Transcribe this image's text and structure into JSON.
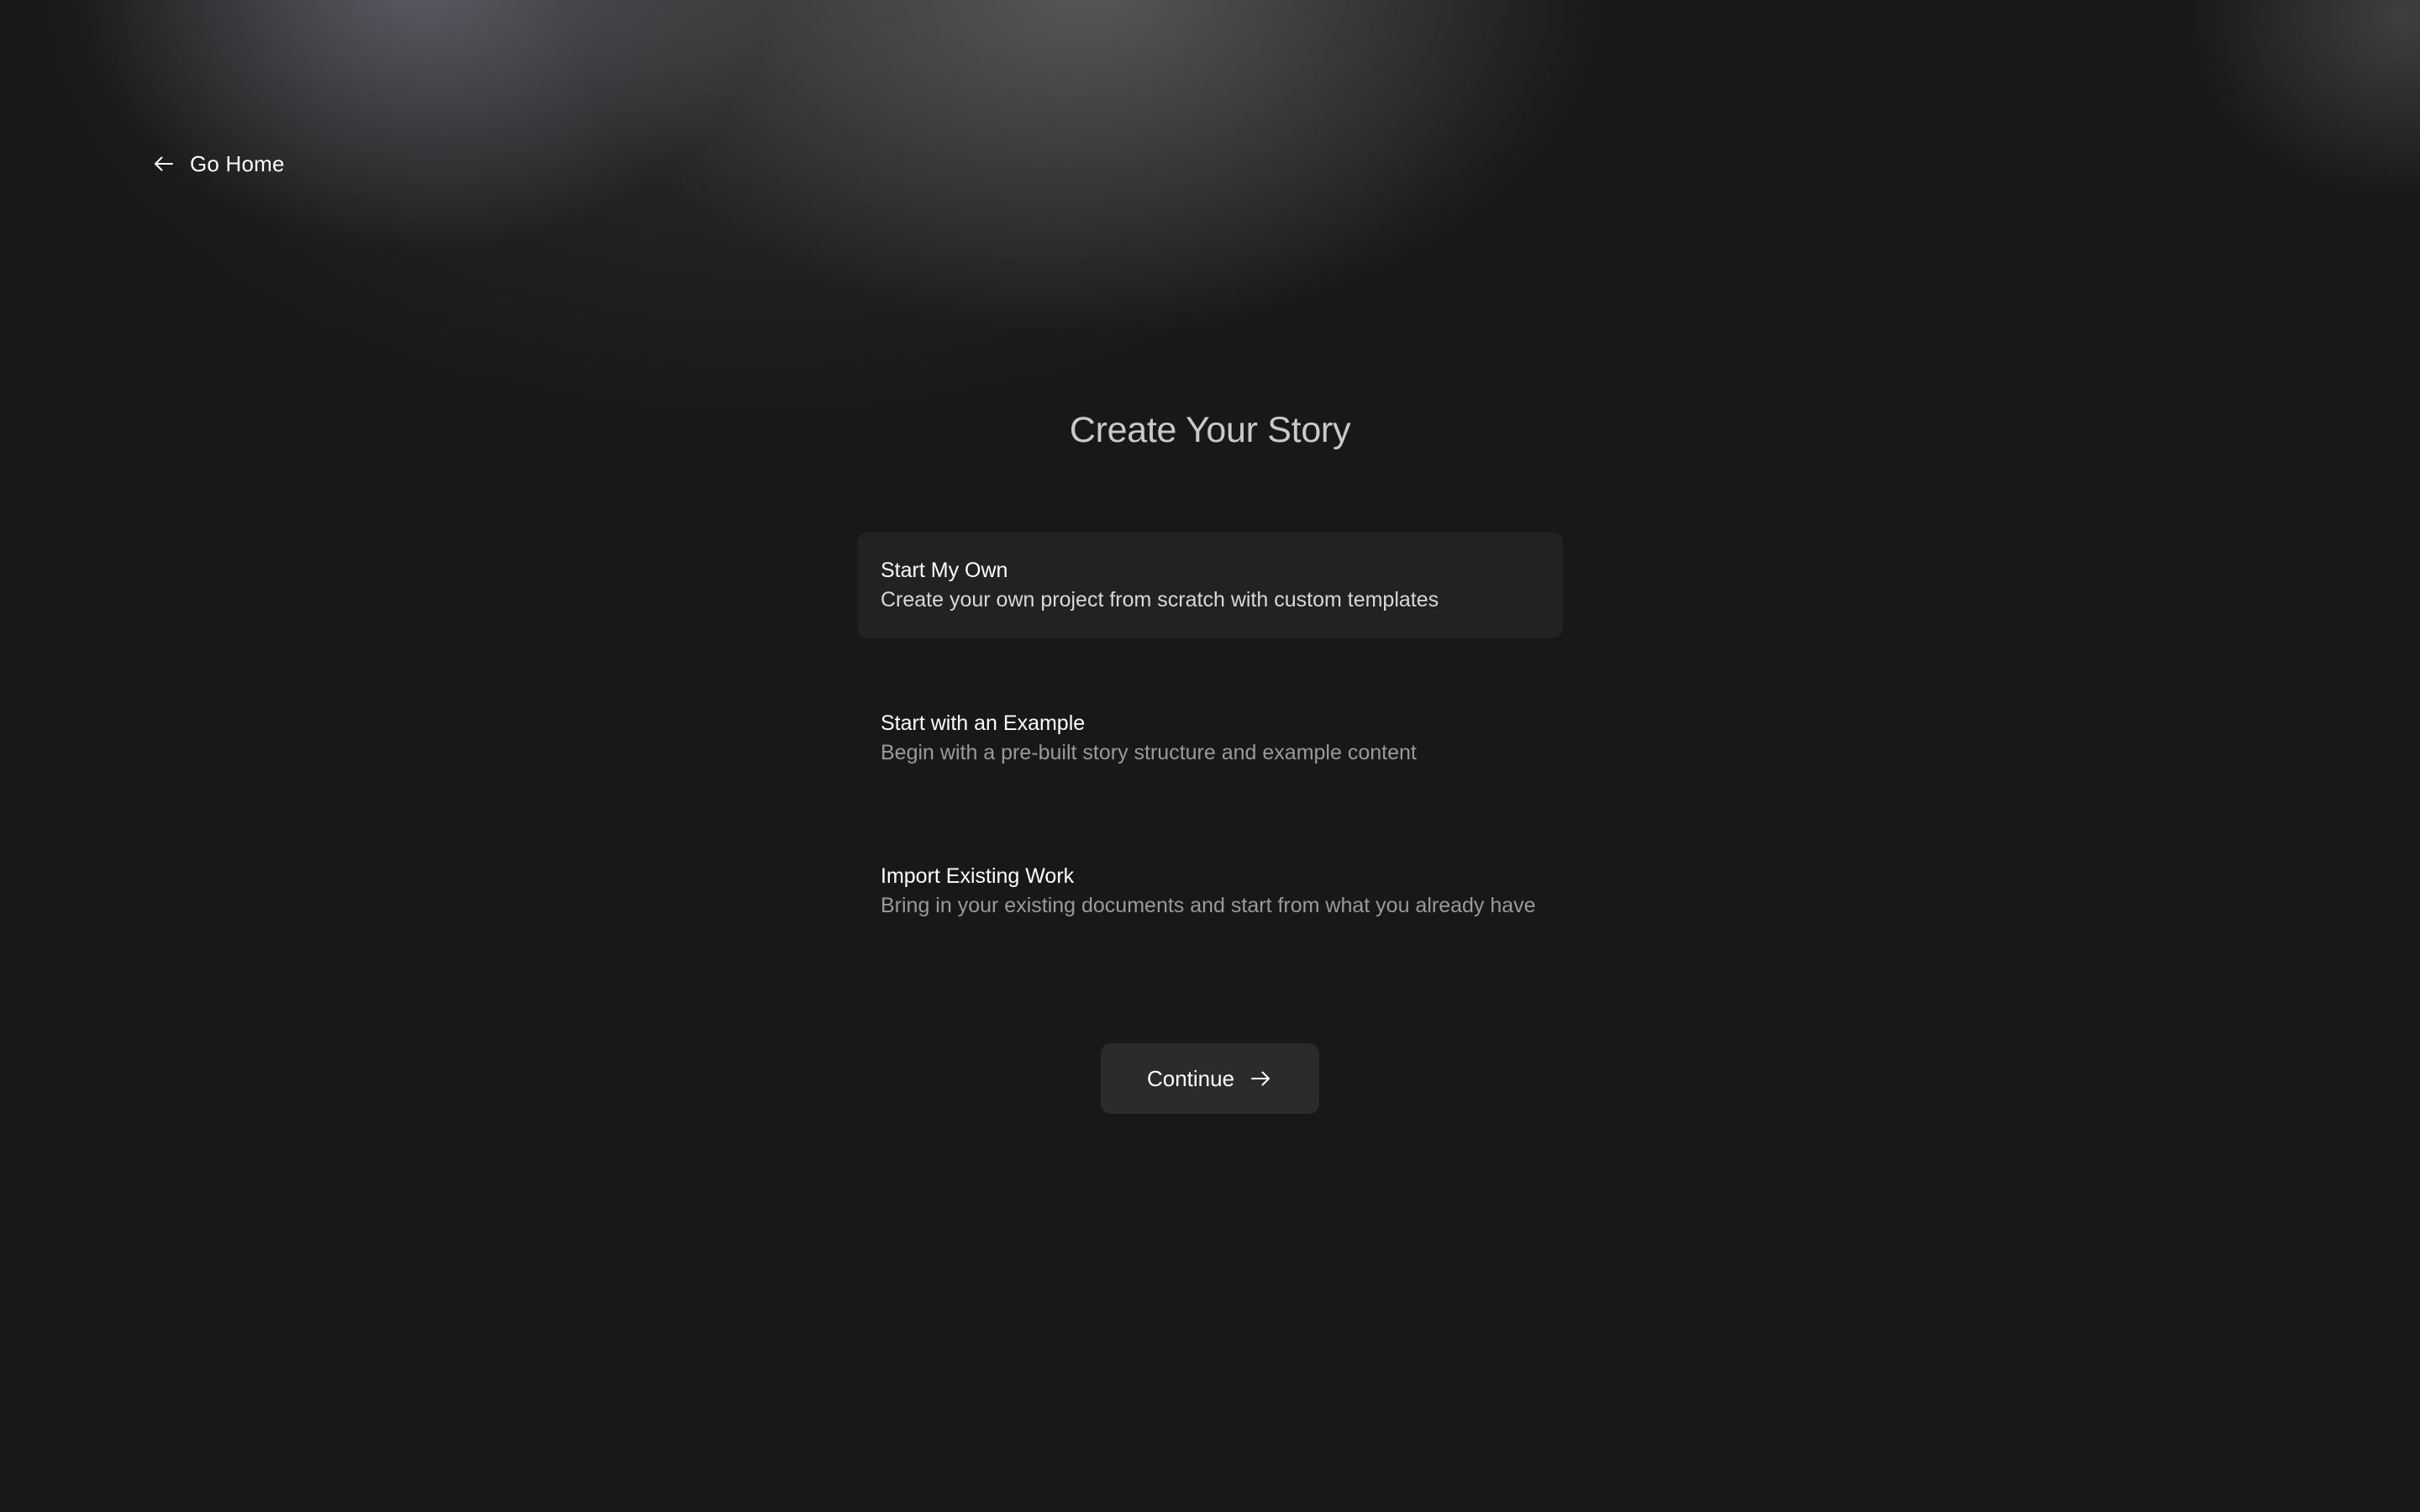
{
  "nav": {
    "back_label": "Go Home",
    "back_icon": "arrow-left-icon"
  },
  "page": {
    "title": "Create Your Story"
  },
  "options": [
    {
      "title": "Start My Own",
      "description": "Create your own project from scratch with custom templates",
      "selected": true
    },
    {
      "title": "Start with an Example",
      "description": "Begin with a pre-built story structure and example content",
      "selected": false
    },
    {
      "title": "Import Existing Work",
      "description": "Bring in your existing documents and start from what you already have",
      "selected": false
    }
  ],
  "actions": {
    "continue_label": "Continue",
    "continue_icon": "arrow-right-icon"
  },
  "colors": {
    "background": "#181818",
    "selected_card": "#222222",
    "button": "#2b2b2b",
    "title_text": "#c9c9c9",
    "muted_text": "#9a9a9a"
  }
}
